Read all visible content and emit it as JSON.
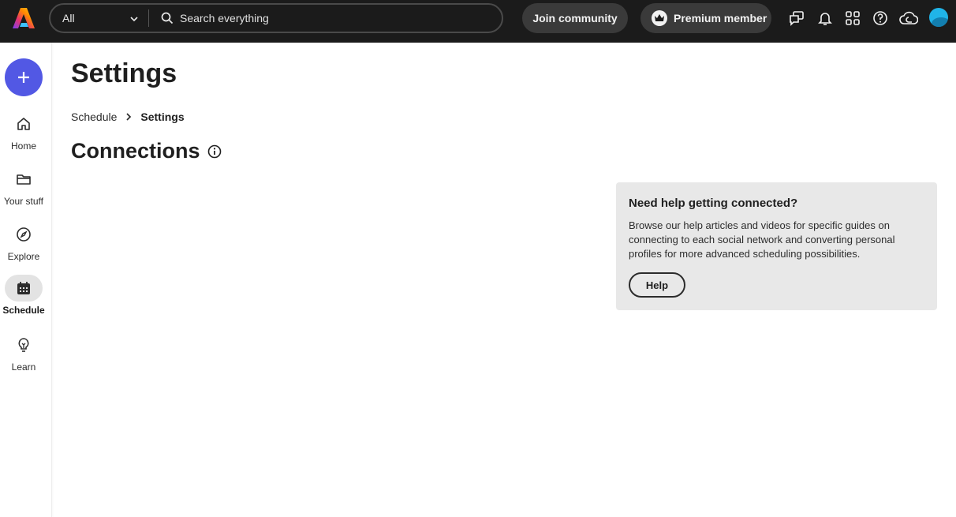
{
  "topbar": {
    "filter_label": "All",
    "search_placeholder": "Search everything",
    "join_label": "Join community",
    "premium_label": "Premium member"
  },
  "sidebar": {
    "items": [
      {
        "label": "Home",
        "icon": "home-icon"
      },
      {
        "label": "Your stuff",
        "icon": "folder-icon"
      },
      {
        "label": "Explore",
        "icon": "compass-icon"
      },
      {
        "label": "Schedule",
        "icon": "calendar-icon",
        "active": true
      },
      {
        "label": "Learn",
        "icon": "lightbulb-icon"
      }
    ]
  },
  "main": {
    "title": "Settings",
    "breadcrumb": [
      "Schedule",
      "Settings"
    ],
    "section_title": "Connections"
  },
  "help_card": {
    "heading": "Need help getting connected?",
    "body": "Browse our help articles and videos for specific guides on connecting to each social network and converting personal profiles for more advanced scheduling possibilities.",
    "button_label": "Help"
  },
  "colors": {
    "topbar_bg": "#1b1b1b",
    "create_button": "#5258e4",
    "avatar": "#20b4e8",
    "help_card_bg": "#e8e8e8"
  }
}
